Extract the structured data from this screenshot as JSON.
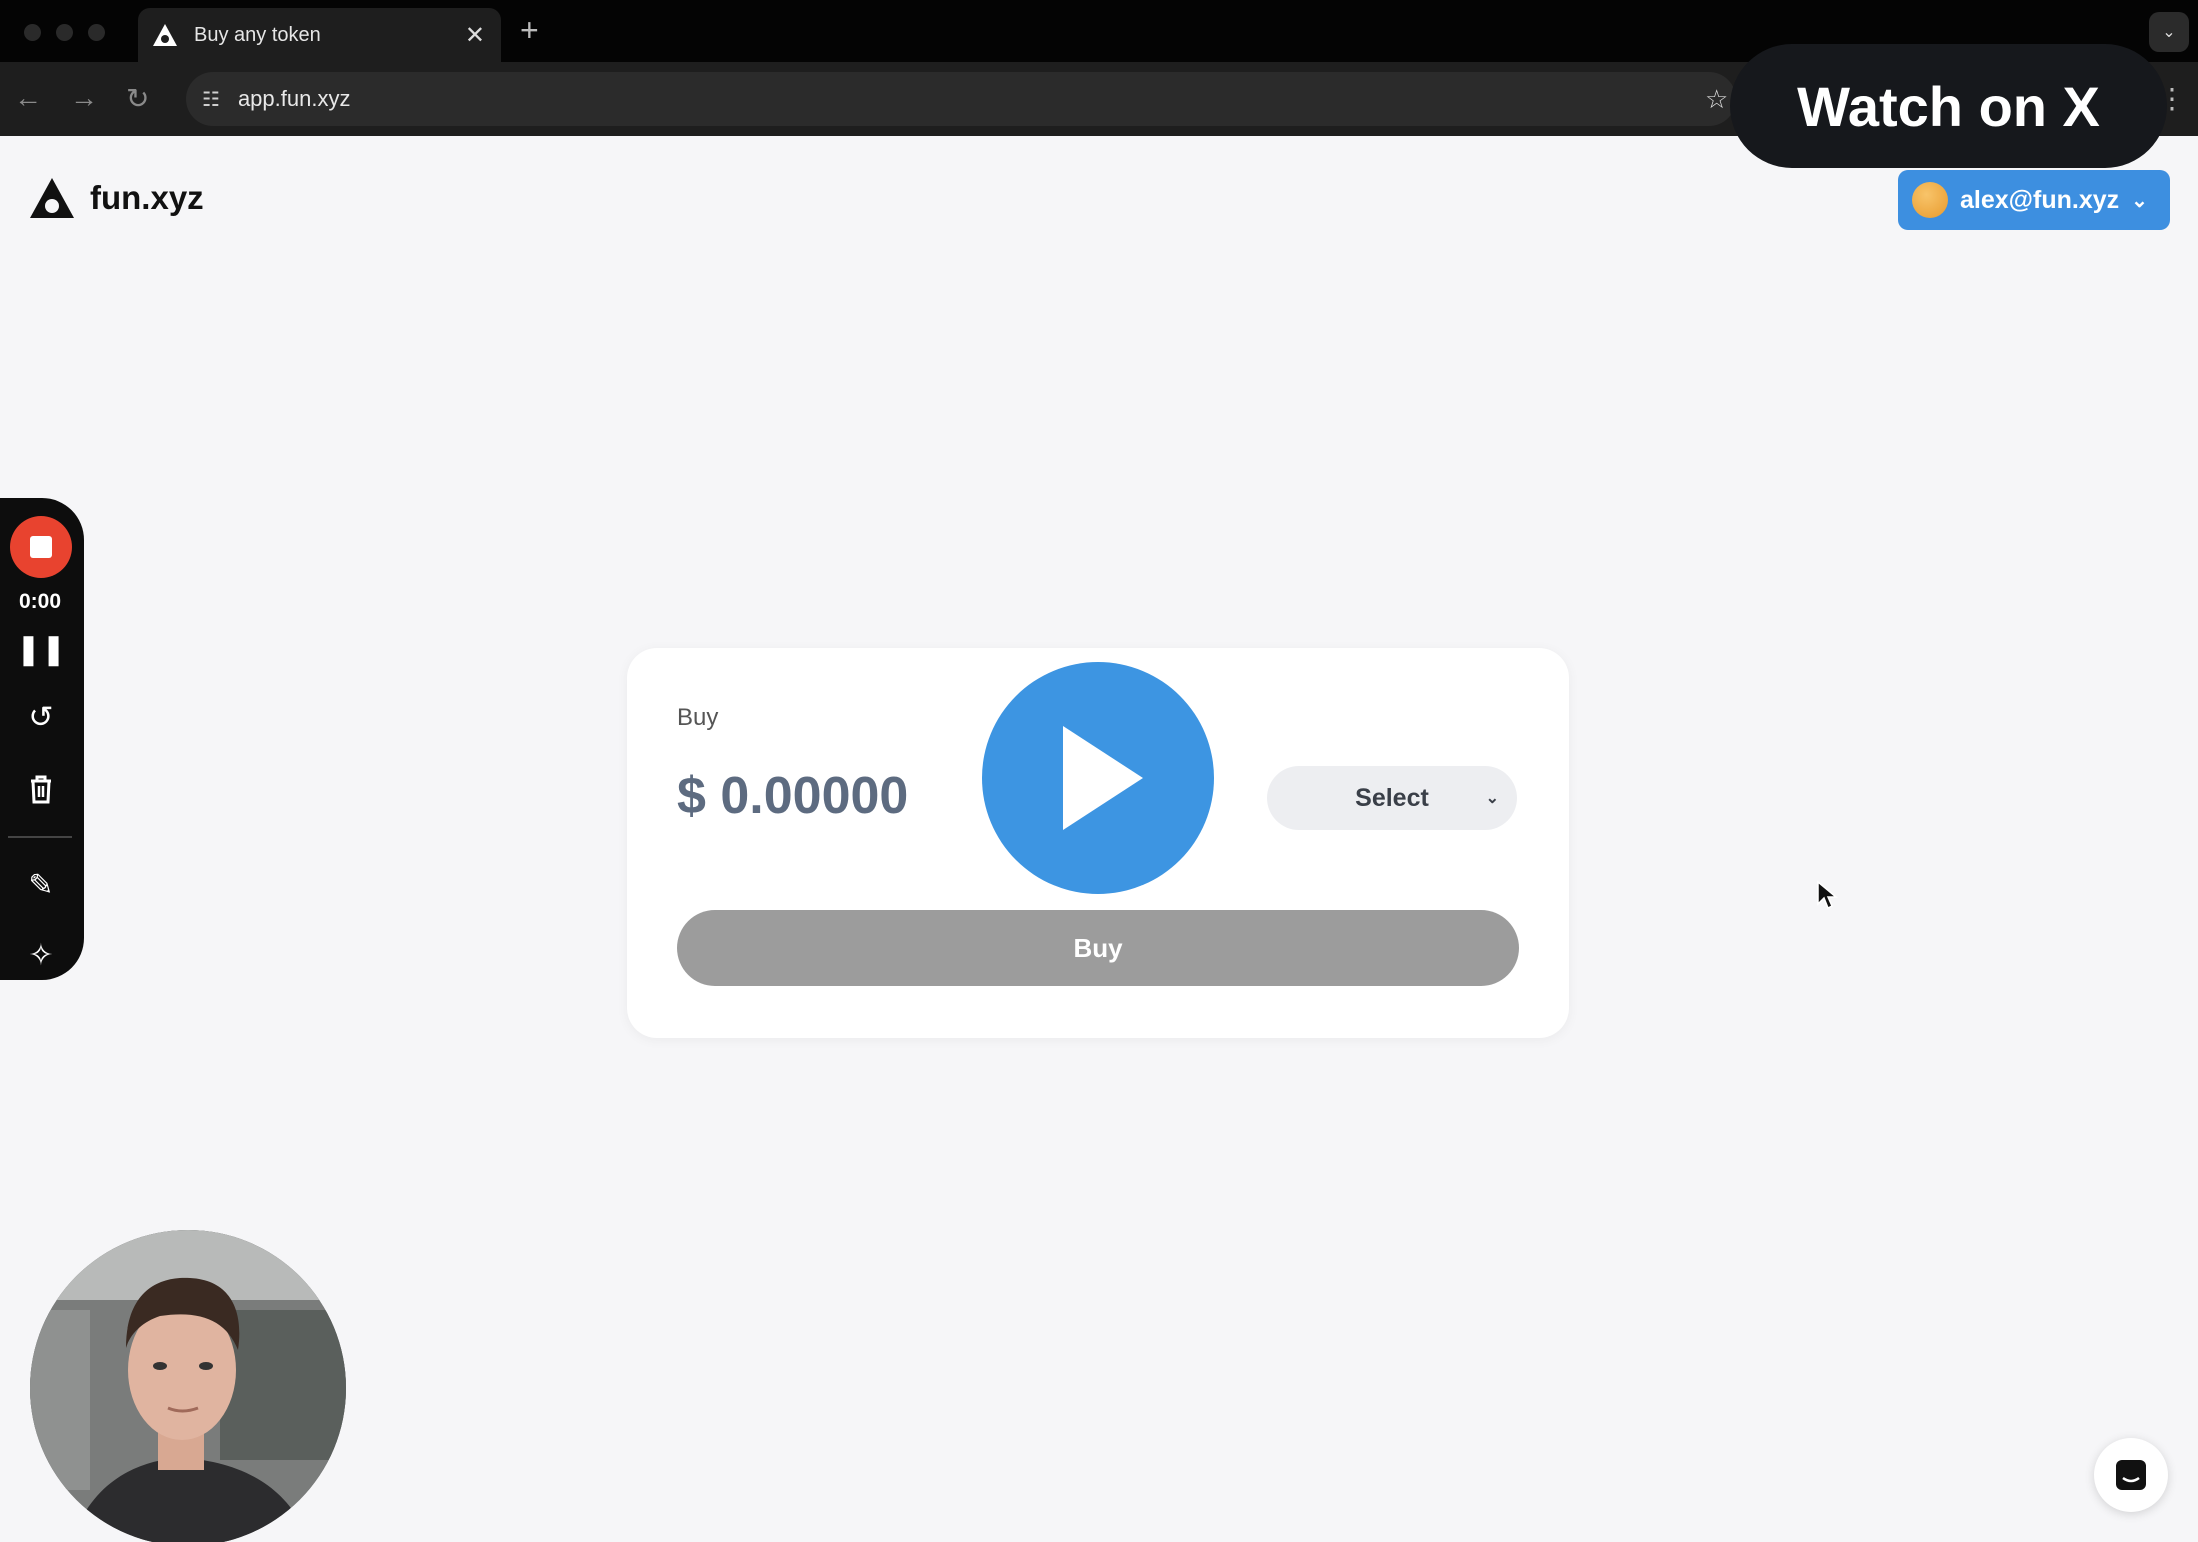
{
  "browser": {
    "tab_title": "Buy any token",
    "url": "app.fun.xyz"
  },
  "overlay": {
    "watch_label": "Watch on X"
  },
  "header": {
    "logo_text": "fun.xyz",
    "account_email": "alex@fun.xyz"
  },
  "recorder": {
    "time": "0:00"
  },
  "card": {
    "label": "Buy",
    "currency_symbol": "$",
    "amount": "0.00000",
    "select_label": "Select",
    "buy_button": "Buy"
  },
  "colors": {
    "accent": "#3d95e2",
    "record": "#e8432f",
    "button_disabled": "#9c9c9c"
  }
}
